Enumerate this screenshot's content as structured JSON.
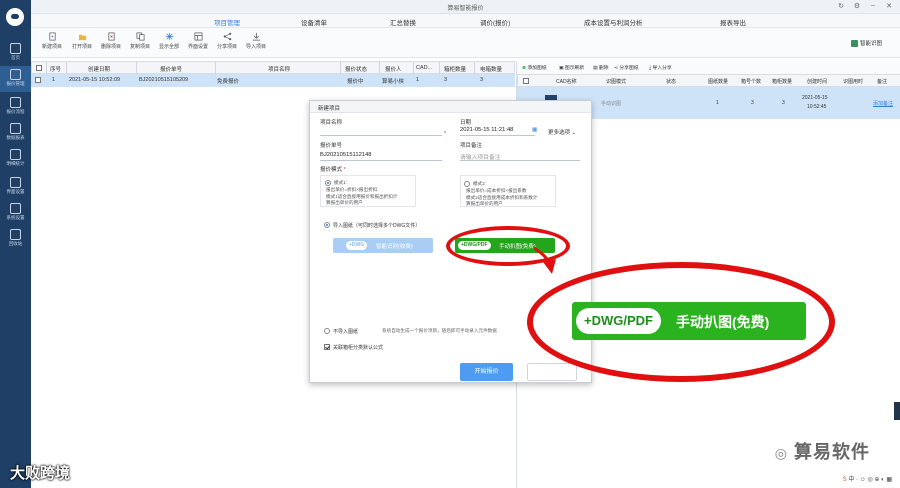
{
  "app": {
    "title": "算易智能报价"
  },
  "sidebar": [
    {
      "label": "首页"
    },
    {
      "label": "报价管理"
    },
    {
      "label": "报价流程"
    },
    {
      "label": "数据报表"
    },
    {
      "label": "明细统计"
    },
    {
      "label": "界面设置"
    },
    {
      "label": "系统设置"
    },
    {
      "label": "回收站"
    }
  ],
  "nav": {
    "tabs": [
      {
        "label": "项目管理"
      },
      {
        "label": "设备清单"
      },
      {
        "label": "汇总替换"
      },
      {
        "label": "调价(报价)"
      },
      {
        "label": "成本设置与利润分析"
      },
      {
        "label": "报表导出"
      }
    ]
  },
  "toolbar": {
    "buttons": [
      {
        "label": "新建项目"
      },
      {
        "label": "打开项目"
      },
      {
        "label": "删除项目"
      },
      {
        "label": "复制项目"
      },
      {
        "label": "显示全部"
      },
      {
        "label": "界面设置"
      },
      {
        "label": "分享项目"
      },
      {
        "label": "导入项目"
      }
    ],
    "smart_label": "智能识图"
  },
  "project_table": {
    "columns": [
      "序号",
      "创建日期",
      "报价单号",
      "项目名称",
      "报价状态",
      "报价人",
      "CAD...",
      "箱柜数量",
      "电箱数量"
    ],
    "rows": [
      {
        "no": "1",
        "date": "2021-05-15 10:52:09",
        "code": "BJ20210515105209",
        "name": "免费报价",
        "status": "报价中",
        "person": "算易小侠",
        "cad": "1",
        "cabinets": "3",
        "boxes": "3"
      }
    ]
  },
  "cad_panel": {
    "tools": [
      "添加图纸",
      "图示刷新",
      "删除",
      "分享图纸",
      "导入分享"
    ],
    "columns": [
      "CAD名称",
      "识图模式",
      "状态",
      "图纸数量",
      "箱号个数",
      "箱柜数量",
      "创建时间",
      "识图用时",
      "备注"
    ],
    "rows": [
      {
        "mode": "手动识图",
        "sheets": "1",
        "box_no": "3",
        "cabinets": "3",
        "created_date": "2021-05-15",
        "created_time": "10:52:45",
        "note": "添加备注"
      }
    ]
  },
  "dialog": {
    "title": "新建项目",
    "name_label": "项目名称",
    "name_value": "",
    "date_label": "日期",
    "date_value": "2021-05-15 11:21:48",
    "more_label": "更多选项",
    "code_label": "报价单号",
    "code_value": "BJ20210515112148",
    "remark_label": "项目备注",
    "remark_placeholder": "请输入项目备注",
    "mode_label": "报价模式",
    "mode1": {
      "title": "模式1:",
      "formula": "报出单价=折扣×报出折扣",
      "desc1": "模式1适合直接用报价和报出折扣计",
      "desc2": "算报出单价的用户"
    },
    "mode2": {
      "title": "模式2:",
      "formula": "报出单价=成本折扣×报出系数",
      "desc1": "模式2适合直接用成本折扣和系数计",
      "desc2": "算报出单价的用户"
    },
    "import_label": "导入图纸（可同时选择多个DWG文件）",
    "smart_pill": "+DWG",
    "smart_text": "智能识别(收费)",
    "manual_pill": "+DWG/PDF",
    "manual_text": "手动扒图(免费)",
    "noimport_label": "不导入图纸",
    "noimport_desc": "系统自动生成一个报价项目，随后即可手动录入元件数据",
    "formula_check": "关联箱柜分类默认公式",
    "start_label": "开始报价"
  },
  "callout": {
    "pill": "+DWG/PDF",
    "text": "手动扒图(免费)"
  },
  "watermarks": {
    "right": "算易软件",
    "left": "大败跨境"
  },
  "colors": {
    "sidebar": "#1f3f66",
    "accent": "#2f7fe0",
    "green": "#24a51c",
    "highlight": "#e01010"
  }
}
